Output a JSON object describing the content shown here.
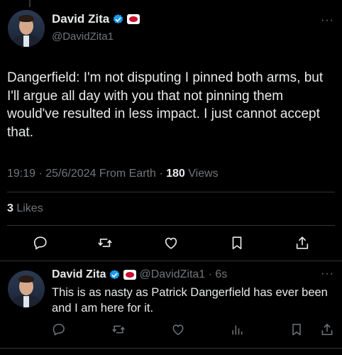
{
  "main_tweet": {
    "author_name": "David Zita",
    "handle": "@DavidZita1",
    "more_glyph": "···",
    "text": "Dangerfield: I'm not disputing I pinned both arms, but I'll argue all day with you that not pinning them would've resulted in less impact. I just cannot accept that.",
    "timestamp": "19:19 · 25/6/2024 From Earth · ",
    "views_count": "180",
    "views_label": " Views",
    "likes_count": "3",
    "likes_label": " Likes"
  },
  "reply_tweet": {
    "author_name": "David Zita",
    "handle_time": "@DavidZita1 · 6s",
    "more_glyph": "···",
    "text": "This is as nasty as Patrick Dangerfield has ever been and I am here for it."
  },
  "colors": {
    "background": "#000000",
    "text": "#e7e9ea",
    "muted": "#71767b",
    "verified": "#1d9bf0",
    "divider": "#2f3336"
  },
  "icons": {
    "main_actions": [
      "reply-icon",
      "retweet-icon",
      "like-icon",
      "bookmark-icon",
      "share-icon"
    ],
    "reply_actions": [
      "reply-icon",
      "retweet-icon",
      "like-icon",
      "views-icon",
      "bookmark-icon",
      "share-icon"
    ]
  }
}
